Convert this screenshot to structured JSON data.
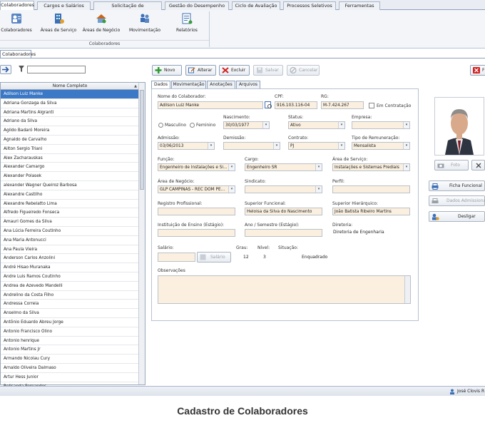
{
  "menu_tabs": [
    "Colaboradores",
    "Cargos e Salários",
    "Solicitação de Colaboradores",
    "Gestão do Desempenho",
    "Ciclo de Avaliação",
    "Processos Seletivos",
    "Ferramentas"
  ],
  "ribbon": {
    "buttons": [
      "Colaboradores",
      "Áreas de Serviço",
      "Áreas de Negócio",
      "Movimentação",
      "Relatórios"
    ],
    "group_label": "Colaboradores"
  },
  "document_tab": "Colaboradores",
  "list": {
    "column_header": "Nome Completo",
    "rows": [
      "Adilson Luiz Manke",
      "Adriana Gonzaga da Silva",
      "Adriana Martins Algranti",
      "Adriano da Silva",
      "Agildo Badaró Moreira",
      "Agnaldo de Carvalho",
      "Ailton Sergio Triani",
      "Alex Zacharauskas",
      "Alexander Camargo",
      "Alexander Polasek",
      "alexander Wagner Queiroz Barbosa",
      "Alexandre Castilho",
      "Alexandre Rebelatto Lima",
      "Alfredo Figueiredo Fonseca",
      "Amauri Gomes da Silva",
      "Ana Lúcia Ferreira Coutinho",
      "Ana Maria Antonucci",
      "Ana Paula Vieira",
      "Anderson Carlos Anzolini",
      "André Hisao Muranaka",
      "Andre Luis Ramos Coutinho",
      "Andrea de Azevedo Mandelli",
      "Andrelino da Costa Filho",
      "Andressa Correia",
      "Anselmo da Silva",
      "Antônio Eduardo Abreu Jorge",
      "Antonio Francisco Olino",
      "Antonio henrique",
      "Antonio Martins Jr",
      "Armando Nicolau Cury",
      "Arnaldo Oliveira Dalmaso",
      "Artur Hess Junior",
      "Belisanda Fernandes"
    ],
    "selected_index": 0
  },
  "toolbar": {
    "novo": "Novo",
    "alterar": "Alterar",
    "excluir": "Excluir",
    "salvar": "Salvar",
    "cancelar": "Cancelar",
    "fechar": "F"
  },
  "form_tabs": [
    "Dados",
    "Movimentação",
    "Anotações",
    "Arquivos"
  ],
  "form": {
    "nome_label": "Nome do Colaborador:",
    "nome": "Adilson Luiz Manke",
    "cpf_label": "CPF:",
    "cpf": "916.103.116-04",
    "rg_label": "RG:",
    "rg": "M-7.424.267",
    "contratacao_label": "Em Contratação",
    "masculino": "Masculino",
    "feminino": "Feminino",
    "nascimento_label": "Nascimento:",
    "nascimento": "30/03/1977",
    "status_label": "Status:",
    "status": "Ativo",
    "empresa_label": "Empresa:",
    "empresa": "",
    "admissao_label": "Admissão:",
    "admissao": "03/06/2013",
    "demissao_label": "Demissão:",
    "demissao": "",
    "contrato_label": "Contrato:",
    "contrato": "PJ",
    "remuneracao_label": "Tipo de Remuneração:",
    "remuneracao": "Mensalista",
    "funcao_label": "Função:",
    "funcao": "Engenheiro de Instalações e Si...",
    "cargo_label": "Cargo:",
    "cargo": "Engenheiro SR",
    "area_servico_label": "Área de Serviço:",
    "area_servico": "Instalações e Sistemas Prediais",
    "area_negocio_label": "Área de Negócio:",
    "area_negocio": "GLP CAMPINAS - REC DOM PE...",
    "sindicato_label": "Sindicato:",
    "sindicato": "",
    "perfil_label": "Perfil:",
    "perfil": "",
    "registro_label": "Registro Profissional:",
    "registro": "",
    "sup_funcional_label": "Superior Funcional:",
    "sup_funcional": "Heloisa da Silva do Nascimento",
    "sup_hierarquico_label": "Superior Hierárquico:",
    "sup_hierarquico": "João Batista Ribeiro Martins",
    "instituicao_label": "Instituição de Ensino (Estágio):",
    "instituicao": "",
    "ano_label": "Ano / Semestre (Estágio):",
    "ano": "",
    "diretoria_label": "Diretoria:",
    "diretoria": "Diretoria de Engenharia",
    "salario_label": "Salário:",
    "salario": "",
    "salario_btn": "Salário",
    "grau_label": "Grau:",
    "grau": "12",
    "nivel_label": "Nível:",
    "nivel": "3",
    "situacao_label": "Situação:",
    "situacao": "Enquadrado",
    "observacoes_label": "Observações"
  },
  "side": {
    "foto": "Foto",
    "ficha": "Ficha Funcional",
    "dados_adm": "Dados Admissionais",
    "desligar": "Desligar"
  },
  "status_user": "José Clovis R",
  "caption": "Cadastro de Colaboradores",
  "colors": {
    "accent": "#3b78c6",
    "field_bg": "#fbf0df",
    "novo": "#2e9a2e",
    "excluir": "#d42020"
  }
}
